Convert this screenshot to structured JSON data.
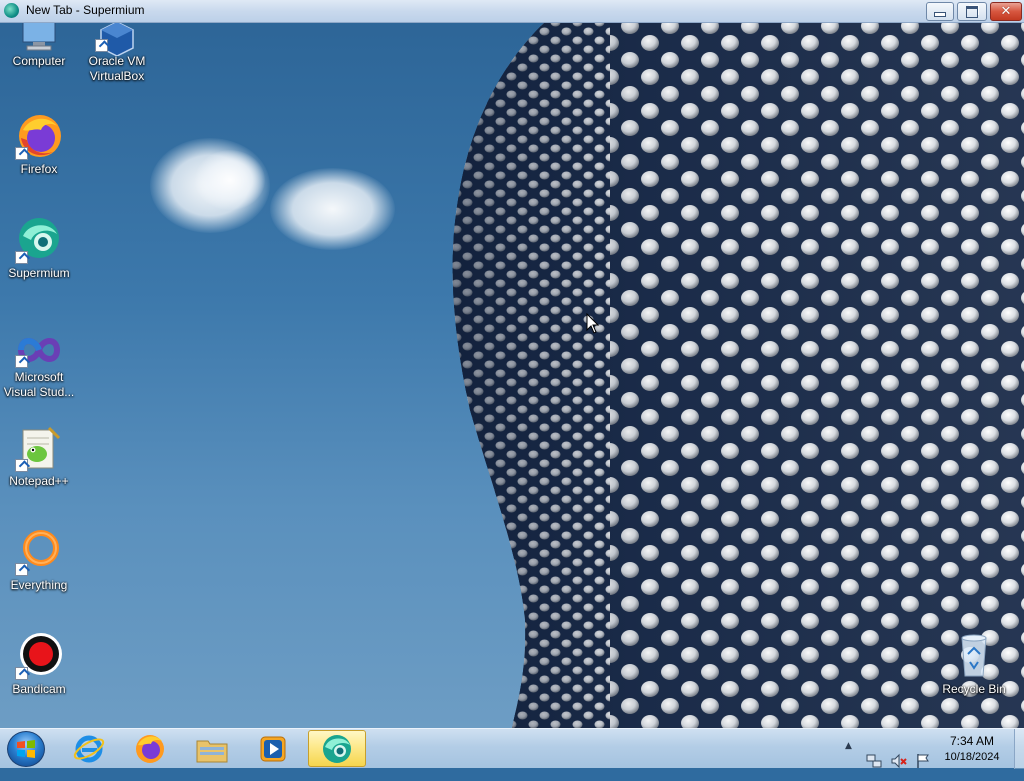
{
  "window": {
    "title": "New Tab - Supermium",
    "app_icon": "supermium-icon",
    "controls": [
      "minimize",
      "maximize",
      "close"
    ],
    "close_glyph": "✕"
  },
  "desktop": {
    "icons": [
      {
        "label": "Computer",
        "icon": "computer-icon"
      },
      {
        "label": "Oracle VM VirtualBox",
        "icon": "virtualbox-icon"
      },
      {
        "label": "Firefox",
        "icon": "firefox-icon"
      },
      {
        "label": "Supermium",
        "icon": "supermium-icon"
      },
      {
        "label": "Microsoft Visual Stud...",
        "icon": "visual-studio-icon"
      },
      {
        "label": "Notepad++",
        "icon": "notepadpp-icon"
      },
      {
        "label": "Everything",
        "icon": "everything-icon"
      },
      {
        "label": "Bandicam",
        "icon": "bandicam-icon"
      },
      {
        "label": "Recycle Bin",
        "icon": "recycle-bin-icon"
      }
    ]
  },
  "taskbar": {
    "start": "windows-start-icon",
    "pinned": [
      {
        "name": "Internet Explorer",
        "icon": "internet-explorer-icon",
        "active": false
      },
      {
        "name": "Firefox",
        "icon": "firefox-icon",
        "active": false
      },
      {
        "name": "Windows Explorer",
        "icon": "file-explorer-icon",
        "active": false
      },
      {
        "name": "Media Player",
        "icon": "media-player-icon",
        "active": false
      },
      {
        "name": "Supermium",
        "icon": "supermium-icon",
        "active": true
      }
    ],
    "tray": {
      "overflow": "▲",
      "time": "7:34 AM",
      "date": "10/18/2024"
    }
  },
  "colors": {
    "sky": "#2f6b9f",
    "taskbar": "#b3cde6",
    "active_task": "#fde98c",
    "close_button": "#d7563f"
  }
}
